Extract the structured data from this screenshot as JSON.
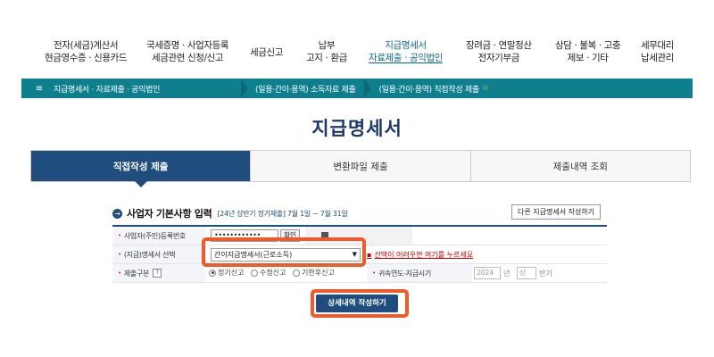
{
  "nav": {
    "items": [
      {
        "line1": "전자(세금)계산서",
        "line2": "현금영수증 · 신용카드"
      },
      {
        "line1": "국세증명 · 사업자등록",
        "line2": "세금관련 신청/신고"
      },
      {
        "line1": "세금신고",
        "line2": ""
      },
      {
        "line1": "납부",
        "line2": "고지 · 환급"
      },
      {
        "line1": "지급명세서",
        "line2": "자료제출 · 공익법인"
      },
      {
        "line1": "장려금 · 연말정산",
        "line2": "전자기부금"
      },
      {
        "line1": "상담 · 불복 · 고충",
        "line2": "제보 · 기타"
      },
      {
        "line1": "세무대리",
        "line2": "납세관리"
      }
    ]
  },
  "breadcrumb": {
    "menu_icon": "≡",
    "items": [
      "지급명세서 · 자료제출 · 공익법인",
      "(일용·간이·용역) 소득자료 제출",
      "(일용·간이·용역) 직접작성 제출"
    ],
    "star": "☆"
  },
  "page_title": "지급명세서",
  "tabs": [
    "직접작성 제출",
    "변환파일 제출",
    "제출내역 조회"
  ],
  "section": {
    "bullet": "→",
    "title": "사업자 기본사항 입력",
    "period": "[24년 상반기 정기제출] 7월 1일 ~ 7월 31일",
    "other_button": "다른 지급명세서 작성하기"
  },
  "form": {
    "rrn_label": "사업자(주민)등록번호",
    "rrn_value": "••••••••••••",
    "confirm_button": "확인",
    "type_label": "(지급)명세서 선택",
    "type_value": "간이지급명세서(근로소득)",
    "help_link": "선택이 어려우면 여기를 누르세요",
    "submit_label": "제출구분",
    "help_icon": "?",
    "radio_options": [
      "정기신고",
      "수정신고",
      "기한후신고"
    ],
    "year_label": "귀속연도-지급시기",
    "year_value": "2024",
    "year_unit": "년",
    "half_value": "상",
    "half_unit": "반기"
  },
  "detail_button": "상세내역 작성하기",
  "colors": {
    "accent": "#1f4e7e",
    "breadcrumb": "#0e7f8d",
    "highlight": "#f05a2a"
  }
}
